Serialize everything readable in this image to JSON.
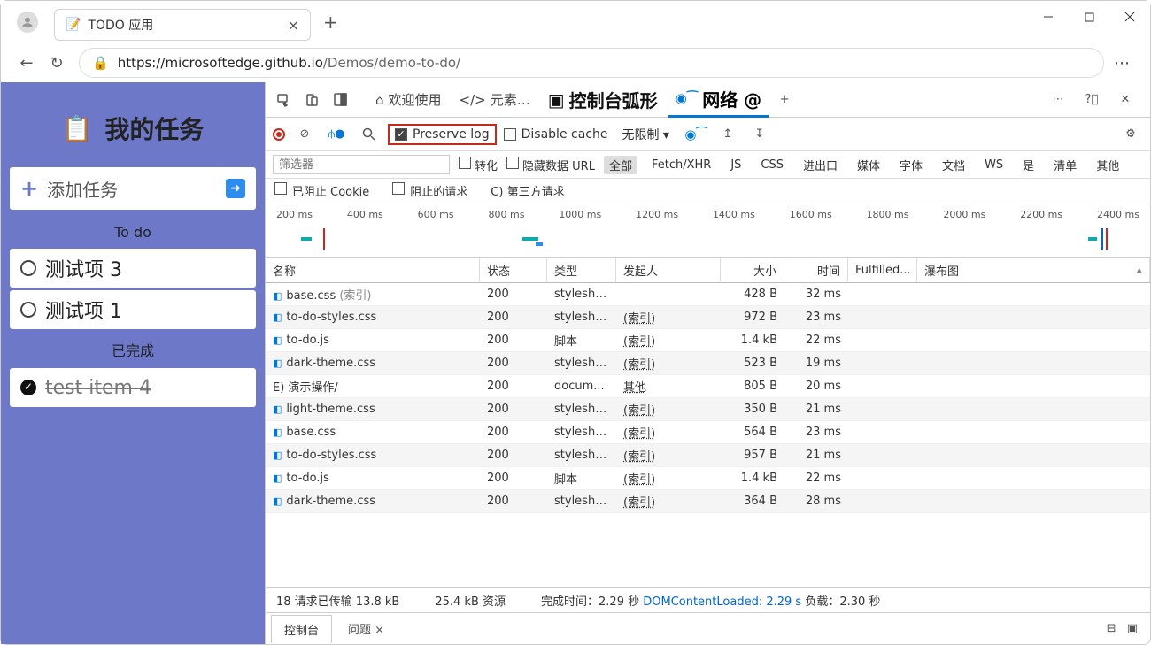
{
  "browser": {
    "tab_title": "TODO 应用",
    "url_host": "https://microsoftedge.github.io",
    "url_path": "/Demos/demo-to-do/"
  },
  "app": {
    "title": "我的任务",
    "add_task": "添加任务",
    "todo_label": "To do",
    "done_label": "已完成",
    "todo_items": [
      "测试项 3",
      "测试项 1"
    ],
    "done_items": [
      "test item 4"
    ]
  },
  "devtools": {
    "tabs": {
      "welcome": "欢迎使用",
      "elements": "元素…",
      "console": "控制台弧形",
      "network": "网络 @"
    },
    "toolbar": {
      "preserve": "Preserve log",
      "disable_cache": "Disable cache",
      "throttle": "无限制"
    },
    "filters": {
      "placeholder": "筛选器",
      "invert": "转化",
      "hide": "隐藏数据 URL",
      "all": "全部",
      "fetch": "Fetch/XHR",
      "js": "JS",
      "css": "CSS",
      "img": "进出口",
      "media": "媒体",
      "font": "字体",
      "doc": "文档",
      "ws": "WS",
      "wasm": "是",
      "manifest": "清单",
      "other": "其他",
      "blocked_cookies": "已阻止 Cookie",
      "blocked_req": "阻止的请求",
      "third": "C) 第三方请求"
    },
    "timeline_ticks": [
      "200 ms",
      "400 ms",
      "600 ms",
      "800 ms",
      "1000 ms",
      "1200 ms",
      "1400 ms",
      "1600 ms",
      "1800 ms",
      "2000 ms",
      "2200 ms",
      "2400 ms"
    ],
    "columns": {
      "name": "名称",
      "status": "状态",
      "type": "类型",
      "initiator": "发起人",
      "size": "大小",
      "time": "时间",
      "fulfilled": "Fulfilled...",
      "waterfall": "瀑布图"
    },
    "rows": [
      {
        "name": "base.css",
        "hint": "(索引)",
        "status": "200",
        "type": "styleshe...",
        "init": "",
        "size": "428 B",
        "time": "32 ms"
      },
      {
        "name": "to-do-styles.css",
        "hint": "",
        "status": "200",
        "type": "styleshe...",
        "init": "(索引)",
        "size": "972 B",
        "time": "23 ms"
      },
      {
        "name": "to-do.js",
        "hint": "",
        "status": "200",
        "type": "脚本",
        "init": "(索引)",
        "size": "1.4 kB",
        "time": "22 ms"
      },
      {
        "name": "dark-theme.css",
        "hint": "",
        "status": "200",
        "type": "styleshe...",
        "init": "(索引)",
        "size": "523 B",
        "time": "19 ms"
      },
      {
        "name": "E) 演示操作/",
        "hint": "",
        "status": "200",
        "type": "docum...",
        "init": "其他",
        "size": "805 B",
        "time": "20 ms",
        "plain": true
      },
      {
        "name": "light-theme.css",
        "hint": "",
        "status": "200",
        "type": "styleshe...",
        "init": "(索引)",
        "size": "350 B",
        "time": "21 ms"
      },
      {
        "name": "base.css",
        "hint": "",
        "status": "200",
        "type": "styleshe...",
        "init": "(索引)",
        "size": "564 B",
        "time": "23 ms"
      },
      {
        "name": "to-do-styles.css",
        "hint": "",
        "status": "200",
        "type": "styleshe...",
        "init": "(索引)",
        "size": "957 B",
        "time": "21 ms"
      },
      {
        "name": "to-do.js",
        "hint": "",
        "status": "200",
        "type": "脚本",
        "init": "(索引)",
        "size": "1.4 kB",
        "time": "22 ms"
      },
      {
        "name": "dark-theme.css",
        "hint": "",
        "status": "200",
        "type": "styleshe...",
        "init": "(索引)",
        "size": "364 B",
        "time": "28 ms"
      }
    ],
    "summary": {
      "req": "18 请求已传输 13.8 kB",
      "res": "25.4 kB 资源",
      "finish": "完成时间：2.29 秒",
      "dcl": "DOMContentLoaded: 2.29 s",
      "load": "负载：2.30 秒"
    },
    "drawer": {
      "console": "控制台",
      "issues": "问题"
    }
  }
}
